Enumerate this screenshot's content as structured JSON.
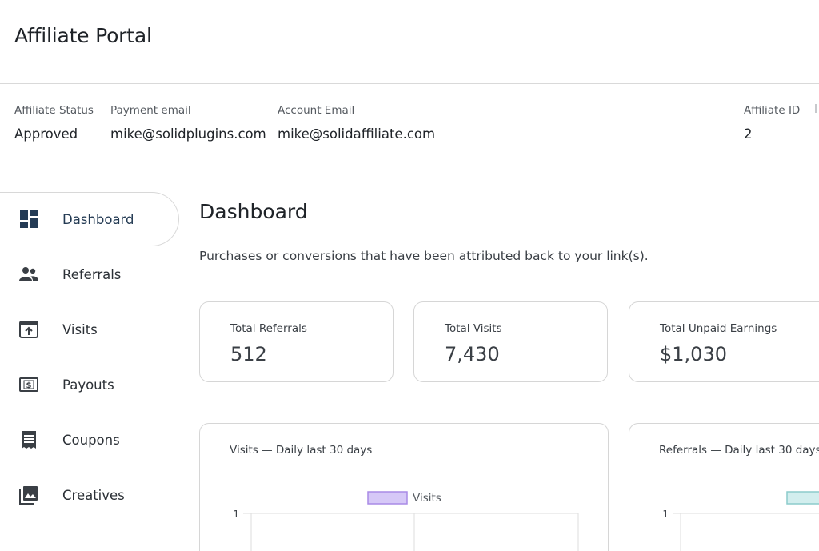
{
  "header": {
    "title": "Affiliate Portal"
  },
  "info": {
    "status": {
      "label": "Affiliate Status",
      "value": "Approved"
    },
    "payment_email": {
      "label": "Payment email",
      "value": "mike@solidplugins.com"
    },
    "account_email": {
      "label": "Account Email",
      "value": "mike@solidaffiliate.com"
    },
    "affiliate_id": {
      "label": "Affiliate ID",
      "value": "2"
    }
  },
  "sidebar": {
    "items": [
      {
        "label": "Dashboard",
        "icon": "dashboard-icon",
        "active": true
      },
      {
        "label": "Referrals",
        "icon": "people-icon",
        "active": false
      },
      {
        "label": "Visits",
        "icon": "visits-icon",
        "active": false
      },
      {
        "label": "Payouts",
        "icon": "payouts-icon",
        "active": false
      },
      {
        "label": "Coupons",
        "icon": "coupons-icon",
        "active": false
      },
      {
        "label": "Creatives",
        "icon": "creatives-icon",
        "active": false
      }
    ]
  },
  "main": {
    "title": "Dashboard",
    "description": "Purchases or conversions that have been attributed back to your link(s).",
    "stats": [
      {
        "label": "Total Referrals",
        "value": "512"
      },
      {
        "label": "Total Visits",
        "value": "7,430"
      },
      {
        "label": "Total Unpaid Earnings",
        "value": "$1,030"
      }
    ]
  },
  "colors": {
    "visits_series": "#d6c8f7",
    "visits_series_border": "#a98ae6",
    "referrals_series": "#d2eeee",
    "referrals_series_border": "#8ccccc",
    "active_nav_text": "#233a53"
  },
  "chart_data": [
    {
      "type": "line",
      "title": "Visits — Daily last 30 days",
      "series": [
        {
          "name": "Visits",
          "values": []
        }
      ],
      "y_ticks": [
        "1"
      ],
      "legend_position": "top"
    },
    {
      "type": "line",
      "title": "Referrals — Daily last 30 days",
      "series": [
        {
          "values": []
        }
      ],
      "y_ticks": [
        "1"
      ],
      "legend_position": "top"
    }
  ]
}
